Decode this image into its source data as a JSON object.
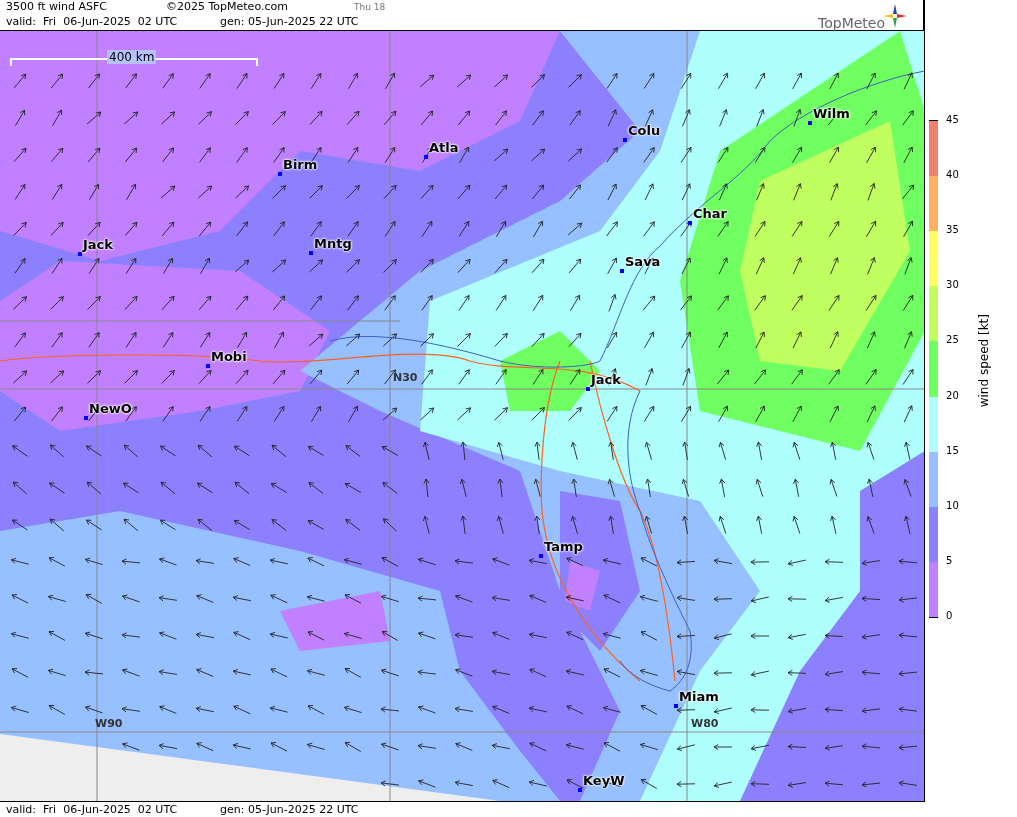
{
  "header": {
    "title": "3500 ft wind ASFC",
    "copyright": "©2025 TopMeteo.com",
    "run_label": "Thu 18",
    "valid": "valid:  Fri  06-Jun-2025  02 UTC",
    "generated": "gen: 05-Jun-2025 22 UTC",
    "logo": "TopMeteo"
  },
  "map": {
    "scale": "400 km",
    "grid_labels": [
      "N30",
      "W90",
      "W80"
    ],
    "cities": [
      "Birm",
      "Atla",
      "Colu",
      "Wilm",
      "Jack",
      "Mntg",
      "Char",
      "Sava",
      "Mobi",
      "Jack",
      "NewO",
      "Tamp",
      "Miam",
      "KeyW"
    ]
  },
  "legend": {
    "title": "wind speed [kt]",
    "ticks": [
      "45",
      "40",
      "35",
      "30",
      "25",
      "20",
      "15",
      "10",
      "5",
      "0"
    ],
    "bands": [
      {
        "color": "#f08070"
      },
      {
        "color": "#ffb060"
      },
      {
        "color": "#ffff60"
      },
      {
        "color": "#c0ff60"
      },
      {
        "color": "#70ff60"
      },
      {
        "color": "#b0ffff"
      },
      {
        "color": "#96c0ff"
      },
      {
        "color": "#8c80ff"
      },
      {
        "color": "#c080ff"
      }
    ]
  },
  "footer": {
    "valid": "valid:  Fri  06-Jun-2025  02 UTC",
    "generated": "gen: 05-Jun-2025 22 UTC"
  }
}
